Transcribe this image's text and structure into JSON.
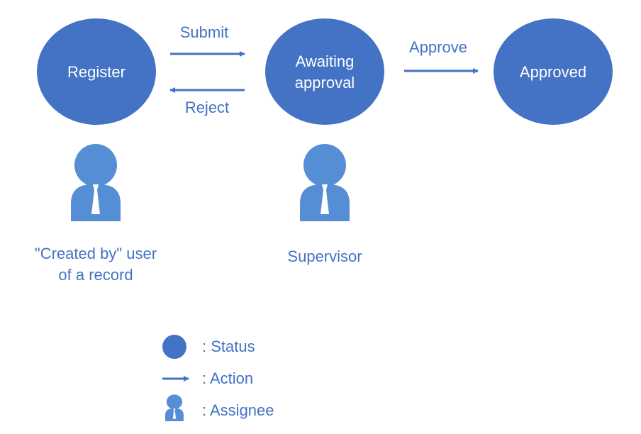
{
  "colors": {
    "status": "#4472C4",
    "assignee": "#558ED5",
    "text": "#4472C4",
    "status_text": "#FFFFFF"
  },
  "statuses": [
    {
      "lines": [
        "Register"
      ]
    },
    {
      "lines": [
        "Awaiting",
        "approval"
      ]
    },
    {
      "lines": [
        "Approved"
      ]
    }
  ],
  "actions": {
    "submit": "Submit",
    "reject": "Reject",
    "approve": "Approve"
  },
  "assignees": [
    {
      "lines": [
        "\"Created by\" user",
        "of a record"
      ]
    },
    {
      "lines": [
        "Supervisor"
      ]
    }
  ],
  "legend": {
    "status": ": Status",
    "action": ": Action",
    "assignee": ": Assignee"
  },
  "icons": {
    "status": "circle",
    "action": "arrow-right",
    "assignee": "person-icon"
  }
}
